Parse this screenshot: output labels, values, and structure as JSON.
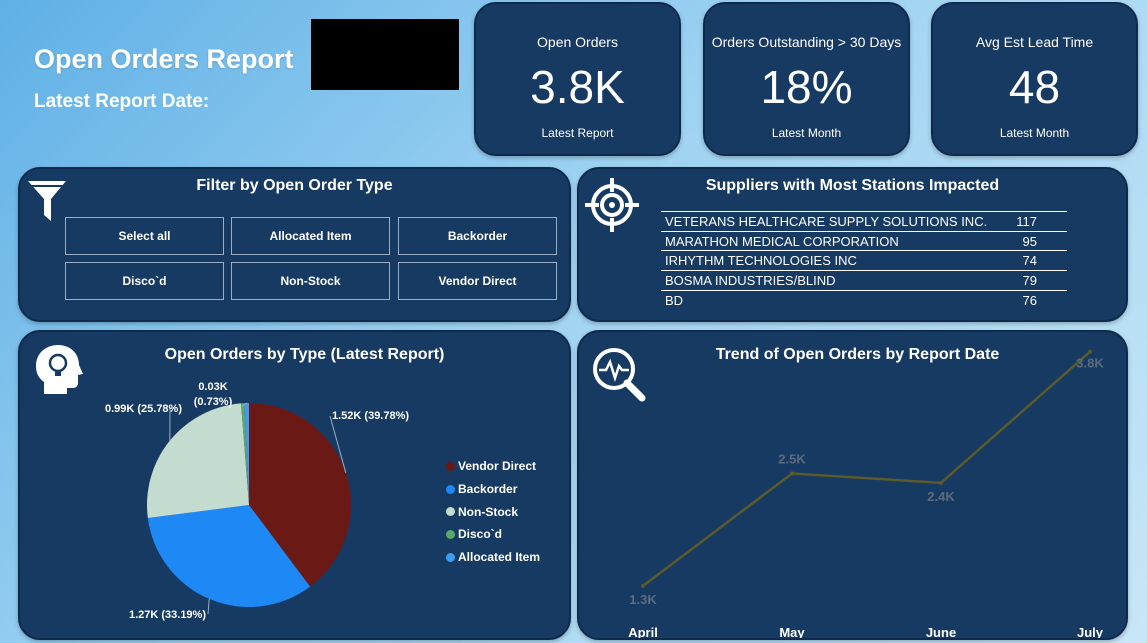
{
  "header": {
    "title": "Open Orders Report",
    "report_date_label": "Latest Report Date:"
  },
  "kpis": [
    {
      "label": "Open Orders",
      "value": "3.8K",
      "footnote": "Latest Report"
    },
    {
      "label": "Orders Outstanding > 30 Days",
      "value": "18%",
      "footnote": "Latest Month"
    },
    {
      "label": "Avg Est Lead Time",
      "value": "48",
      "footnote": "Latest Month"
    }
  ],
  "filter": {
    "title": "Filter by Open Order Type",
    "icon": "funnel-icon",
    "options": [
      "Select all",
      "Allocated Item",
      "Backorder",
      "Disco`d",
      "Non-Stock",
      "Vendor Direct"
    ]
  },
  "suppliers": {
    "title": "Suppliers with Most Stations Impacted",
    "icon": "target-icon",
    "rows": [
      {
        "name": "VETERANS HEALTHCARE SUPPLY SOLUTIONS INC.",
        "count": "117"
      },
      {
        "name": "MARATHON MEDICAL CORPORATION",
        "count": "95"
      },
      {
        "name": "IRHYTHM TECHNOLOGIES INC",
        "count": "74"
      },
      {
        "name": "BOSMA INDUSTRIES/BLIND",
        "count": "79"
      },
      {
        "name": "BD",
        "count": "76"
      }
    ]
  },
  "pie": {
    "icon": "head-lightbulb-icon",
    "colors": {
      "vendor_direct": "#6b1914",
      "backorder": "#1e88f5",
      "non_stock": "#c4dcd0",
      "discod": "#5aa86a",
      "allocated_item": "#3f9bf0"
    }
  },
  "trend": {
    "icon": "magnifier-pulse-icon",
    "line_color": "#5a5a2a",
    "label_color": "#5c6b7c"
  },
  "chart_data": [
    {
      "type": "pie",
      "title": "Open Orders by Type (Latest Report)",
      "slices": [
        {
          "name": "Vendor Direct",
          "value": 1.52,
          "label": "1.52K (39.78%)",
          "percent": 39.78
        },
        {
          "name": "Backorder",
          "value": 1.27,
          "label": "1.27K (33.19%)",
          "percent": 33.19
        },
        {
          "name": "Non-Stock",
          "value": 0.99,
          "label": "0.99K (25.78%)",
          "percent": 25.78
        },
        {
          "name": "Disco`d",
          "value": 0.0,
          "label": "",
          "percent": 0.52
        },
        {
          "name": "Allocated Item",
          "value": 0.03,
          "label_line1": "0.03K",
          "label_line2": "(0.73%)",
          "percent": 0.73
        }
      ],
      "legend": [
        "Vendor Direct",
        "Backorder",
        "Non-Stock",
        "Disco`d",
        "Allocated Item"
      ]
    },
    {
      "type": "line",
      "title": "Trend of Open Orders by Report Date",
      "categories": [
        "April",
        "May",
        "June",
        "July"
      ],
      "values": [
        1.3,
        2.5,
        2.4,
        3.8
      ],
      "labels": [
        "1.3K",
        "2.5K",
        "2.4K",
        "3.8K"
      ]
    }
  ]
}
